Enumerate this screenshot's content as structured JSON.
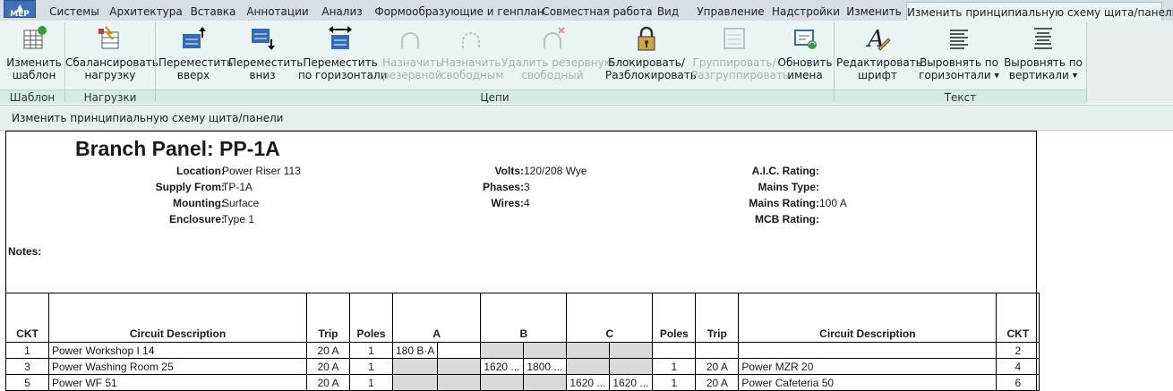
{
  "app_button": {
    "label": "MEP"
  },
  "tabs": [
    "Системы",
    "Архитектура",
    "Вставка",
    "Аннотации",
    "Анализ",
    "Формообразующие и генплан",
    "Совместная работа",
    "Вид",
    "Управление",
    "Надстройки",
    "Изменить",
    "Изменить принципиальную схему щита/панели"
  ],
  "ribbon": {
    "buttons": [
      {
        "line1": "Изменить",
        "line2": "шаблон",
        "icon": "edit-template-icon",
        "enabled": true
      },
      {
        "line1": "Сбалансировать",
        "line2": "нагрузку",
        "icon": "balance-load-icon",
        "enabled": true
      },
      {
        "line1": "Переместить",
        "line2": "вверх",
        "icon": "move-up-icon",
        "enabled": true
      },
      {
        "line1": "Переместить",
        "line2": "вниз",
        "icon": "move-down-icon",
        "enabled": true
      },
      {
        "line1": "Переместить",
        "line2": "по горизонтали",
        "icon": "move-horizontal-icon",
        "enabled": true
      },
      {
        "line1": "Назначить",
        "line2": "резервной",
        "icon": "assign-spare-icon",
        "enabled": false
      },
      {
        "line1": "Назначить",
        "line2": "свободным",
        "icon": "assign-space-icon",
        "enabled": false
      },
      {
        "line1": "Удалить резервную",
        "line2": "свободный",
        "icon": "remove-spare-icon",
        "enabled": false
      },
      {
        "line1": "Блокировать/",
        "line2": "Разблокировать",
        "icon": "lock-icon",
        "enabled": true
      },
      {
        "line1": "Группировать/",
        "line2": "Разгруппировать",
        "icon": "group-icon",
        "enabled": false
      },
      {
        "line1": "Обновить",
        "line2": "имена",
        "icon": "update-names-icon",
        "enabled": true
      },
      {
        "line1": "Редактировать",
        "line2": "шрифт",
        "icon": "edit-font-icon",
        "enabled": true
      },
      {
        "line1": "Выровнять по",
        "line2": "горизонтали",
        "icon": "align-horizontal-icon",
        "enabled": true
      },
      {
        "line1": "Выровнять по",
        "line2": "вертикали",
        "icon": "align-vertical-icon",
        "enabled": true
      }
    ],
    "groups": [
      "Шаблон",
      "Нагрузки",
      "Цепи",
      "Текст"
    ]
  },
  "context_bar": {
    "label": "Изменить принципиальную схему щита/панели"
  },
  "panel": {
    "title": "Branch Panel: PP-1A",
    "fields": {
      "location": {
        "label": "Location:",
        "value": "Power Riser 113"
      },
      "supply_from": {
        "label": "Supply From:",
        "value": "TP-1A"
      },
      "mounting": {
        "label": "Mounting:",
        "value": "Surface"
      },
      "enclosure": {
        "label": "Enclosure:",
        "value": "Type 1"
      },
      "volts": {
        "label": "Volts:",
        "value": "120/208 Wye"
      },
      "phases": {
        "label": "Phases:",
        "value": "3"
      },
      "wires": {
        "label": "Wires:",
        "value": "4"
      },
      "aic_rating": {
        "label": "A.I.C. Rating:",
        "value": ""
      },
      "mains_type": {
        "label": "Mains Type:",
        "value": ""
      },
      "mains_rating": {
        "label": "Mains Rating:",
        "value": "100 A"
      },
      "mcb_rating": {
        "label": "MCB Rating:",
        "value": ""
      }
    },
    "notes_label": "Notes:"
  },
  "schedule": {
    "headers": {
      "ckt_left": "CKT",
      "desc_left": "Circuit Description",
      "trip_left": "Trip",
      "poles_left": "Poles",
      "phase_a": "A",
      "phase_b": "B",
      "phase_c": "C",
      "poles_right": "Poles",
      "trip_right": "Trip",
      "desc_right": "Circuit Description",
      "ckt_right": "CKT"
    },
    "rows": [
      {
        "ckt_l": "1",
        "desc_l": "Power Workshop I 14",
        "trip_l": "20 A",
        "poles_l": "1",
        "a1": "180 B·A",
        "a2": "",
        "b1": "",
        "b2": "",
        "c1": "",
        "c2": "",
        "poles_r": "",
        "trip_r": "",
        "desc_r": "",
        "ckt_r": "2"
      },
      {
        "ckt_l": "3",
        "desc_l": "Power Washing Room 25",
        "trip_l": "20 A",
        "poles_l": "1",
        "a1": "",
        "a2": "",
        "b1": "1620 ...",
        "b2": "1800 ...",
        "c1": "",
        "c2": "",
        "poles_r": "1",
        "trip_r": "20 A",
        "desc_r": "Power MZR 20",
        "ckt_r": "4"
      },
      {
        "ckt_l": "5",
        "desc_l": "Power WF 51",
        "trip_l": "20 A",
        "poles_l": "1",
        "a1": "",
        "a2": "",
        "b1": "",
        "b2": "",
        "c1": "1620 ...",
        "c2": "1620 ...",
        "poles_r": "1",
        "trip_r": "20 A",
        "desc_r": "Power Cafeteria 50",
        "ckt_r": "6"
      }
    ]
  },
  "colors": {
    "ribbon_bg": "#e9f4f3",
    "tab_strip_bg": "#d6dde3",
    "group_label_bg": "#d4ebe7",
    "app_button": "#3b72b6",
    "shaded_cell": "#d9d9d9",
    "icon_blue": "#2f6db5",
    "icon_green": "#3a9a3a"
  }
}
